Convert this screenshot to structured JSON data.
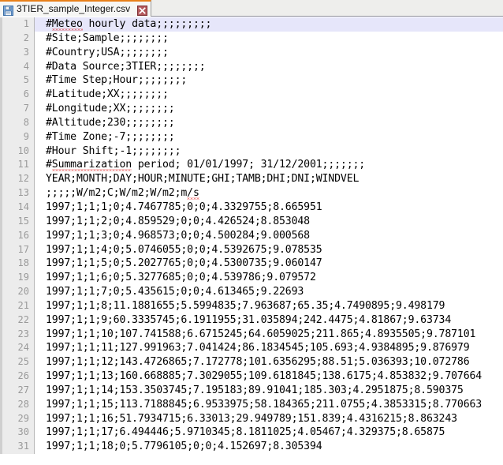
{
  "window": {
    "tab": {
      "filename": "3TIER_sample_Integer.csv",
      "save_icon": "floppy-disk-icon",
      "close_icon": "close-x-icon",
      "accent_color": "#e8801a",
      "close_color": "#a63b3b"
    }
  },
  "editor": {
    "current_line": 1,
    "current_line_highlight": "#e6e6fa",
    "gutter_bg": "#ececec",
    "gutter_text_color": "#9a9a9a",
    "text_color": "#000000",
    "spellcheck_color": "#e01b1b",
    "lines": [
      {
        "n": "1",
        "text": "#Meteo hourly data;;;;;;;;;",
        "spell": "Meteo",
        "spell_start": 1
      },
      {
        "n": "2",
        "text": "#Site;Sample;;;;;;;;"
      },
      {
        "n": "3",
        "text": "#Country;USA;;;;;;;;"
      },
      {
        "n": "4",
        "text": "#Data Source;3TIER;;;;;;;;"
      },
      {
        "n": "5",
        "text": "#Time Step;Hour;;;;;;;;"
      },
      {
        "n": "6",
        "text": "#Latitude;XX;;;;;;;;"
      },
      {
        "n": "7",
        "text": "#Longitude;XX;;;;;;;;"
      },
      {
        "n": "8",
        "text": "#Altitude;230;;;;;;;;"
      },
      {
        "n": "9",
        "text": "#Time Zone;-7;;;;;;;;"
      },
      {
        "n": "10",
        "text": "#Hour Shift;-1;;;;;;;;"
      },
      {
        "n": "11",
        "text": "#Summarization period; 01/01/1997; 31/12/2001;;;;;;;",
        "spell": "Summarization",
        "spell_start": 1
      },
      {
        "n": "12",
        "text": "YEAR;MONTH;DAY;HOUR;MINUTE;GHI;TAMB;DHI;DNI;WINDVEL"
      },
      {
        "n": "13",
        "text": ";;;;;W/m2;C;W/m2;W/m2;m/s",
        "spell": "m/s",
        "spell_start": 23
      },
      {
        "n": "14",
        "text": "1997;1;1;1;0;4.7467785;0;0;4.3329755;8.665951"
      },
      {
        "n": "15",
        "text": "1997;1;1;2;0;4.859529;0;0;4.426524;8.853048"
      },
      {
        "n": "16",
        "text": "1997;1;1;3;0;4.968573;0;0;4.500284;9.000568"
      },
      {
        "n": "17",
        "text": "1997;1;1;4;0;5.0746055;0;0;4.5392675;9.078535"
      },
      {
        "n": "18",
        "text": "1997;1;1;5;0;5.2027765;0;0;4.5300735;9.060147"
      },
      {
        "n": "19",
        "text": "1997;1;1;6;0;5.3277685;0;0;4.539786;9.079572"
      },
      {
        "n": "20",
        "text": "1997;1;1;7;0;5.435615;0;0;4.613465;9.22693"
      },
      {
        "n": "21",
        "text": "1997;1;1;8;11.1881655;5.5994835;7.963687;65.35;4.7490895;9.498179"
      },
      {
        "n": "22",
        "text": "1997;1;1;9;60.3335745;6.1911955;31.035894;242.4475;4.81867;9.63734"
      },
      {
        "n": "23",
        "text": "1997;1;1;10;107.741588;6.6715245;64.6059025;211.865;4.8935505;9.787101"
      },
      {
        "n": "24",
        "text": "1997;1;1;11;127.991963;7.041424;86.1834545;105.693;4.9384895;9.876979"
      },
      {
        "n": "25",
        "text": "1997;1;1;12;143.4726865;7.172778;101.6356295;88.51;5.036393;10.072786"
      },
      {
        "n": "26",
        "text": "1997;1;1;13;160.668885;7.3029055;109.6181845;138.6175;4.853832;9.707664"
      },
      {
        "n": "27",
        "text": "1997;1;1;14;153.3503745;7.195183;89.91041;185.303;4.2951875;8.590375"
      },
      {
        "n": "28",
        "text": "1997;1;1;15;113.7188845;6.9533975;58.184365;211.0755;4.3853315;8.770663"
      },
      {
        "n": "29",
        "text": "1997;1;1;16;51.7934715;6.33013;29.949789;151.839;4.4316215;8.863243"
      },
      {
        "n": "30",
        "text": "1997;1;1;17;6.494446;5.9710345;8.1811025;4.05467;4.329375;8.65875"
      },
      {
        "n": "31",
        "text": "1997;1;1;18;0;5.7796105;0;0;4.152697;8.305394"
      }
    ]
  }
}
